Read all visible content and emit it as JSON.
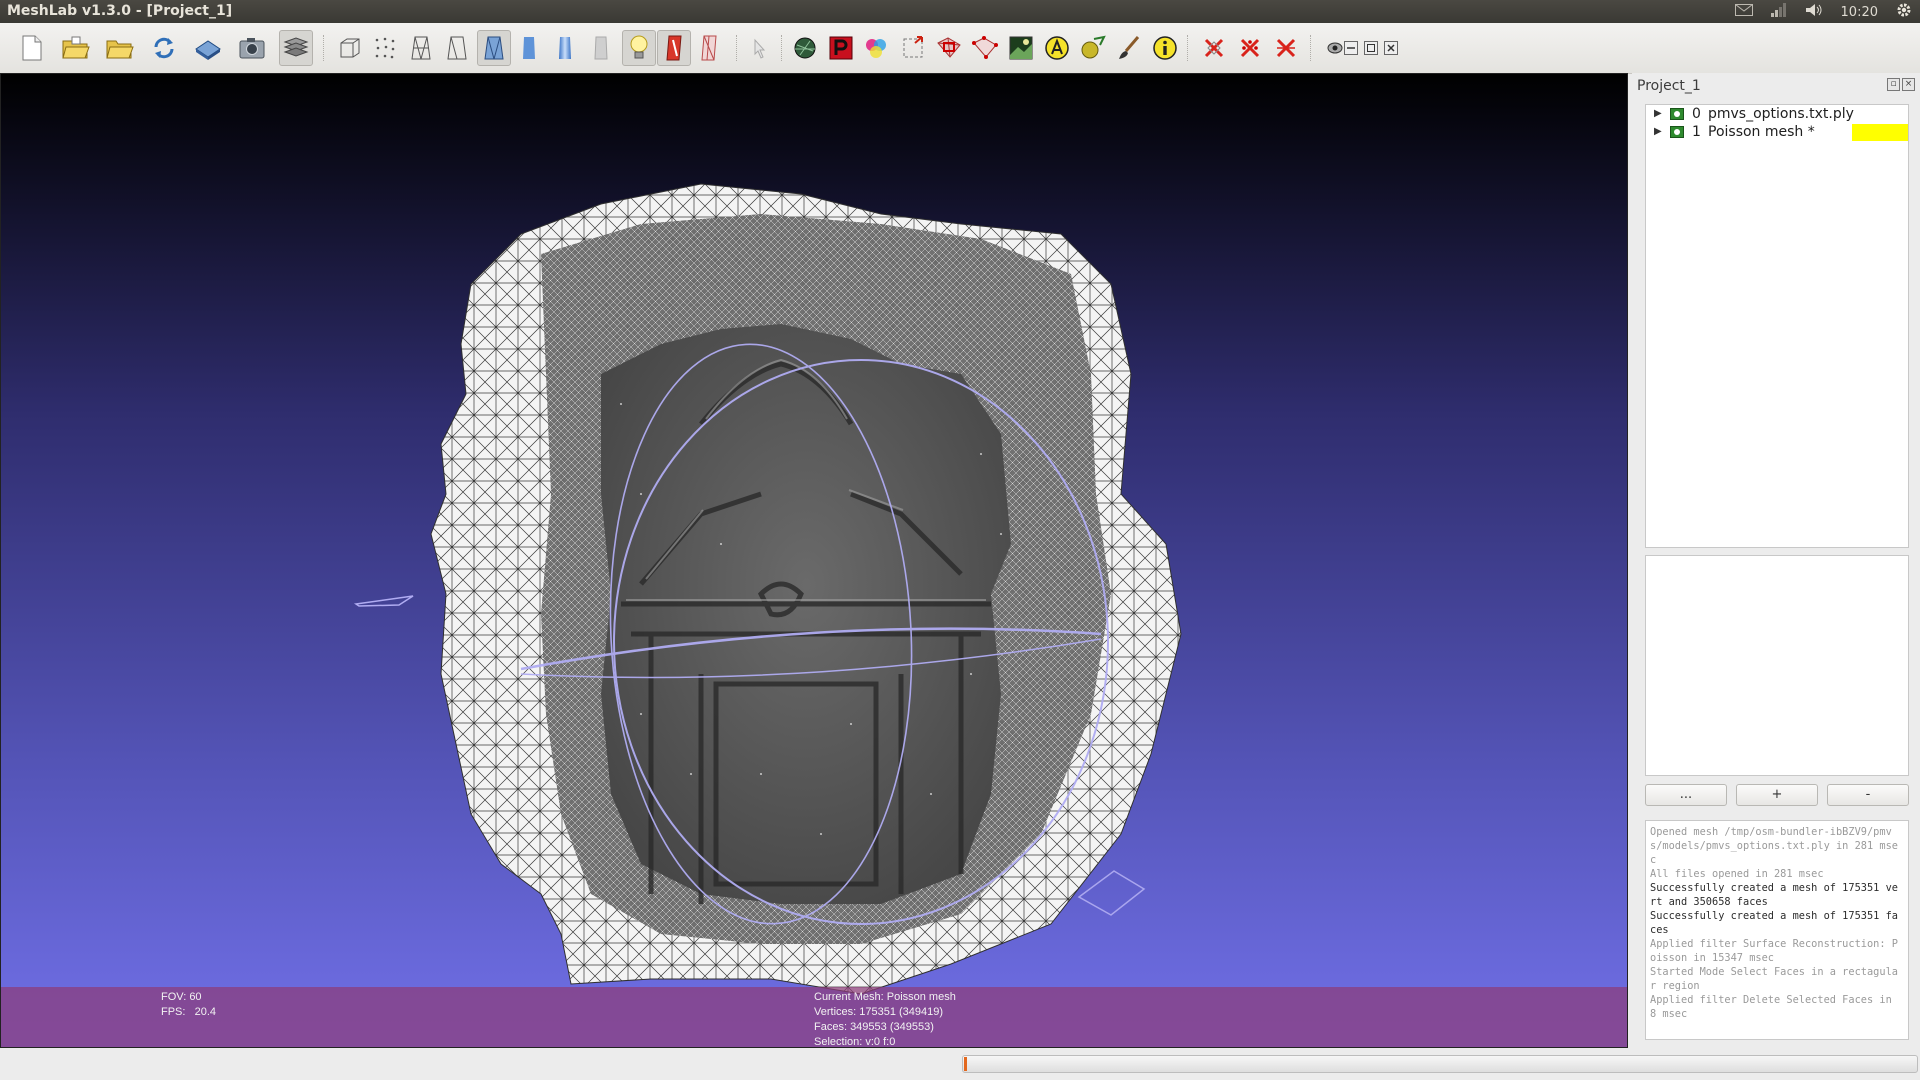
{
  "window": {
    "title": "MeshLab v1.3.0 - [Project_1]"
  },
  "panel_indicators": {
    "clock": "10:20"
  },
  "icons": {
    "top_panel": [
      "mail-icon",
      "network-icon",
      "volume-icon",
      "settings-gear-icon"
    ],
    "toolbar": [
      "new-project-icon",
      "open-project-icon",
      "open-mesh-icon",
      "reload-icon",
      "save-icon",
      "snapshot-icon",
      "layers-icon",
      "bounding-box-icon",
      "points-icon",
      "wireframe-icon",
      "hidden-lines-icon",
      "flat-lines-icon",
      "flat-icon",
      "smooth-icon",
      "texture-icon",
      "light-icon",
      "double-side-icon",
      "backface-icon",
      "inspect-icon",
      "pick-icon",
      "paint-texture-icon",
      "color-icon",
      "manipulator-icon",
      "select-faces-icon",
      "select-vertices-icon",
      "raster-icon",
      "measure-icon",
      "align-icon",
      "brush-icon",
      "info-icon",
      "delete-faces-icon",
      "delete-vertices-icon",
      "delete-faces-vertices-icon",
      "eye-icon",
      "minimize-icon",
      "restore-icon",
      "close-icon"
    ]
  },
  "viewport": {
    "info_left": {
      "fov": "FOV: 60",
      "fps": "FPS:   20.4"
    },
    "info_center": {
      "current_mesh": "Current Mesh: Poisson mesh",
      "vertices": "Vertices: 175351 (349419)",
      "faces": "Faces: 349553 (349553)",
      "selection": "Selection: v:0 f:0"
    }
  },
  "project_panel": {
    "title": "Project_1",
    "layers": [
      {
        "index": "0",
        "name": "pmvs_options.txt.ply",
        "color": ""
      },
      {
        "index": "1",
        "name": "Poisson mesh *",
        "color": "#ffff00"
      }
    ],
    "buttons": {
      "dots": "...",
      "plus": "+",
      "minus": "-"
    },
    "log": [
      {
        "text": "Opened mesh /tmp/osm-bundler-ibBZV9/pmvs/models/pmvs_options.txt.ply in 281 msec",
        "dim": true
      },
      {
        "text": "All files opened in 281 msec",
        "dim": true
      },
      {
        "text": "Successfully created a mesh of 175351 vert and 350658 faces",
        "dim": false
      },
      {
        "text": "Successfully created a mesh of 175351 faces",
        "dim": false
      },
      {
        "text": "Applied filter Surface Reconstruction: Poisson in 15347 msec",
        "dim": true
      },
      {
        "text": "Started Mode Select Faces in a rectagular region",
        "dim": true
      },
      {
        "text": "Applied filter Delete Selected Faces in 8 msec",
        "dim": true
      }
    ]
  },
  "status": {
    "progress": 0.003,
    "progress_color": "#e3681e"
  },
  "colors": {
    "viewport_top": "#000000",
    "viewport_bottom": "#7170e8",
    "info_bar": "#8c3c78",
    "mesh": "#5a5a5a",
    "wire": "#ffffff",
    "trackball": "#a6a2ee"
  }
}
